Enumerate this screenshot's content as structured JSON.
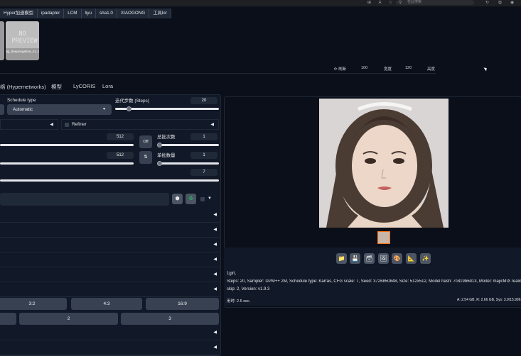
{
  "browser": {
    "search_placeholder": "在此搜索"
  },
  "tabs": [
    "Hyper加速模型",
    "ipadapter",
    "LCM",
    "liyu",
    "sha1.0",
    "XIAOGONG",
    "工具lor"
  ],
  "card": {
    "preview_text": "NO PREVIEW",
    "label": "ng_deepnegative_v1_75t"
  },
  "refresh_row": {
    "refresh_label": "刷新",
    "width_value": "100",
    "width_label": "宽度",
    "height_value": "120",
    "height_label": "高度"
  },
  "subtabs": [
    "络 (Hypernetworks)",
    "模型",
    "LyCORIS",
    "Lora"
  ],
  "schedule": {
    "label": "Schedule type",
    "value": "Automatic"
  },
  "steps": {
    "label": "迭代步数 (Steps)",
    "value": "20",
    "fraction": 0.13
  },
  "refiner": {
    "label": "Refiner"
  },
  "width": {
    "value": "512",
    "fraction": 0.25
  },
  "height": {
    "value": "512",
    "fraction": 0.25
  },
  "batch_count": {
    "label": "总批次数",
    "value": "1",
    "fraction": 0.0
  },
  "batch_size": {
    "label": "单批数量",
    "value": "1",
    "fraction": 0.0
  },
  "cfg": {
    "value": "7",
    "fraction": 0.23
  },
  "off_label": "Off",
  "swap_icon": "⇅",
  "ratio_buttons": [
    "3:2",
    "4:3",
    "16:9"
  ],
  "count_buttons": [
    "2",
    "3"
  ],
  "toolbar_icons": [
    "folder-icon",
    "save-icon",
    "archive-icon",
    "image-icon",
    "palette-icon",
    "ruler-icon",
    "sparkle-icon"
  ],
  "output": {
    "prompt": "1girl,",
    "params": "Steps: 20, Sampler: DPM++ 2M, Schedule type: Karras, CFG scale: 7, Seed: 3726850848, Size: 512x512, Model hash: 7c819b6d13, Model: majicMIX realistic_v",
    "params2": "skip: 2, Version: v1.9.3",
    "time": "用时: 2.5 sec.",
    "vram": "A: 2.54 GB, R: 2.66 GB, Sys: 3.9/15.996"
  },
  "colors": {
    "accent": "#f97316",
    "panel": "#111827",
    "background": "#0b0f19"
  }
}
